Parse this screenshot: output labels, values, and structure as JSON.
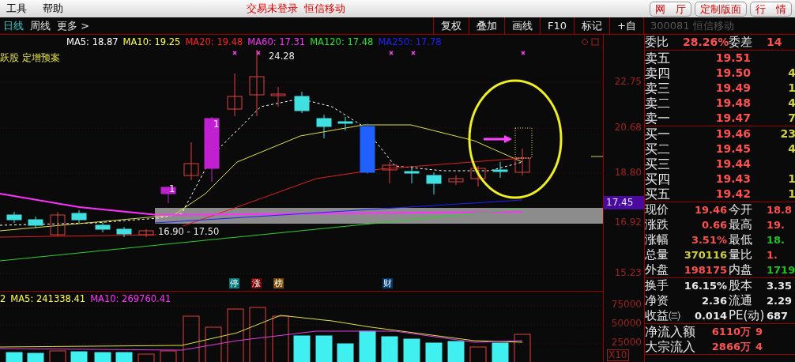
{
  "menu": [
    {
      "label": "工具"
    },
    {
      "label": "帮助"
    }
  ],
  "status_texts": [
    "交易未登录",
    "恒信移动"
  ],
  "top_buttons": [
    "网　厅",
    "定制版面",
    "行　情"
  ],
  "period_tabs": [
    {
      "label": "日线",
      "selected": true
    },
    {
      "label": "周线",
      "selected": false
    },
    {
      "label": "更多 >",
      "selected": false
    }
  ],
  "tools": [
    "复权",
    "叠加",
    "画线",
    "F10",
    "标记",
    "+自"
  ],
  "stock_title": "300081 恒信移动",
  "ma_legend": [
    {
      "label": "MA5: 18.87",
      "color": "#ffffff"
    },
    {
      "label": "MA10: 19.25",
      "color": "#ffff40"
    },
    {
      "label": "MA20: 19.48",
      "color": "#ff2020"
    },
    {
      "label": "MA60: 17.31",
      "color": "#ff30ff"
    },
    {
      "label": "MA120: 17.48",
      "color": "#30e030"
    },
    {
      "label": "MA250: 17.78",
      "color": "#2020ff"
    }
  ],
  "chart_notes": {
    "concept": "跃股 定增预案",
    "high_price": "24.28",
    "zone_range": "16.90 - 17.50",
    "candle_marks": [
      "1",
      "1"
    ]
  },
  "event_tags": [
    {
      "label": "停",
      "color": "#007a7a"
    },
    {
      "label": "涨",
      "color": "#7a0000"
    },
    {
      "label": "榜",
      "color": "#7a4a00"
    },
    {
      "label": "财",
      "color": "#003a7a"
    }
  ],
  "price_axis": [
    "22.75",
    "20.68",
    "18.80",
    "16.92",
    "15.23"
  ],
  "price_tag": "17.45",
  "volume_legend": [
    {
      "label": "2",
      "color": "#ffff40"
    },
    {
      "label": "MA5: 241338.41",
      "color": "#ffff40"
    },
    {
      "label": "MA10: 269760.41",
      "color": "#ff30ff"
    }
  ],
  "volume_axis": [
    "75000",
    "50000",
    "25000"
  ],
  "volume_unit": "X10",
  "quote_header": [
    {
      "kind": "label",
      "text": "委比"
    },
    {
      "kind": "value",
      "text": "28.26%",
      "color": "#ff5050"
    },
    {
      "kind": "label",
      "text": "委差"
    },
    {
      "kind": "value",
      "text": "14",
      "color": "#ff5050"
    }
  ],
  "asks": [
    {
      "label": "卖五",
      "price": "19.51"
    },
    {
      "label": "卖四",
      "price": "19.50",
      "volume": "4"
    },
    {
      "label": "卖三",
      "price": "19.49",
      "volume": "1"
    },
    {
      "label": "卖二",
      "price": "19.48",
      "volume": "4"
    },
    {
      "label": "卖一",
      "price": "19.47",
      "volume": "7"
    }
  ],
  "bids": [
    {
      "label": "买一",
      "price": "19.46",
      "volume": "23"
    },
    {
      "label": "买二",
      "price": "19.45",
      "volume": "4"
    },
    {
      "label": "买三",
      "price": "19.44"
    },
    {
      "label": "买四",
      "price": "19.43",
      "volume": "1"
    },
    {
      "label": "买五",
      "price": "19.42",
      "volume": "1"
    }
  ],
  "stats_sections": [
    [
      [
        {
          "kind": "label",
          "text": "现价"
        },
        {
          "kind": "value",
          "text": "19.46",
          "color": "#ff5050"
        },
        {
          "kind": "label",
          "text": "今开"
        },
        {
          "kind": "value",
          "text": "18.8",
          "color": "#ff5050"
        }
      ],
      [
        {
          "kind": "label",
          "text": "涨跌"
        },
        {
          "kind": "value",
          "text": "0.66",
          "color": "#ff5050"
        },
        {
          "kind": "label",
          "text": "最高"
        },
        {
          "kind": "value",
          "text": "19.",
          "color": "#ff5050"
        }
      ],
      [
        {
          "kind": "label",
          "text": "涨幅"
        },
        {
          "kind": "value",
          "text": "3.51%",
          "color": "#ff5050"
        },
        {
          "kind": "label",
          "text": "最低"
        },
        {
          "kind": "value",
          "text": "18.",
          "color": "#20c020"
        }
      ],
      [
        {
          "kind": "label",
          "text": "总量"
        },
        {
          "kind": "value",
          "text": "370116",
          "color": "#d0d040"
        },
        {
          "kind": "label",
          "text": "量比"
        },
        {
          "kind": "value",
          "text": "1.",
          "color": "#ff5050"
        }
      ],
      [
        {
          "kind": "label",
          "text": "外盘"
        },
        {
          "kind": "value",
          "text": "198175",
          "color": "#ff5050"
        },
        {
          "kind": "label",
          "text": "内盘"
        },
        {
          "kind": "value",
          "text": "1719",
          "color": "#20c020"
        }
      ]
    ],
    [
      [
        {
          "kind": "label",
          "text": "换手"
        },
        {
          "kind": "value",
          "text": "16.15%",
          "color": "#e8e8e8"
        },
        {
          "kind": "label",
          "text": "股本"
        },
        {
          "kind": "value",
          "text": "3.35",
          "color": "#e8e8e8"
        }
      ],
      [
        {
          "kind": "label",
          "text": "净资"
        },
        {
          "kind": "value",
          "text": "2.36",
          "color": "#e8e8e8"
        },
        {
          "kind": "label",
          "text": "流通"
        },
        {
          "kind": "value",
          "text": "2.29",
          "color": "#e8e8e8"
        }
      ],
      [
        {
          "kind": "label",
          "text": "收益㈢"
        },
        {
          "kind": "value",
          "text": "0.014",
          "color": "#e8e8e8"
        },
        {
          "kind": "label",
          "text": "PE(动)"
        },
        {
          "kind": "value",
          "text": "687",
          "color": "#e8e8e8"
        }
      ]
    ],
    [
      [
        {
          "kind": "label",
          "text": "净流入额"
        },
        {
          "kind": "value",
          "text": "6110万",
          "color": "#ff5050"
        },
        {
          "kind": "value",
          "text": "9",
          "color": "#ff5050"
        }
      ],
      [
        {
          "kind": "label",
          "text": "大宗流入"
        },
        {
          "kind": "value",
          "text": "2866万",
          "color": "#ff5050"
        },
        {
          "kind": "value",
          "text": "4",
          "color": "#ff5050"
        }
      ]
    ]
  ]
}
